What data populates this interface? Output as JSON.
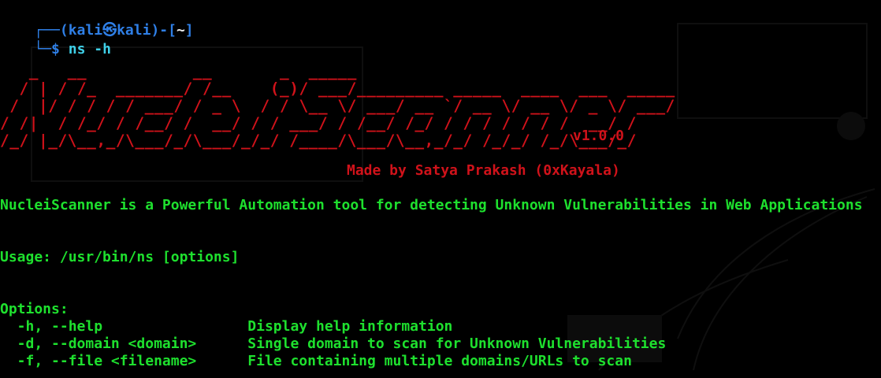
{
  "colors": {
    "background": "#000000",
    "prompt_blue": "#2f7fe6",
    "command_cyan": "#3fd0e8",
    "banner_red": "#d0121a",
    "text_green": "#1ee02e"
  },
  "prompt": {
    "top_deco": "┌──(",
    "user": "kali",
    "skull": "㉿",
    "host": "kali",
    "close": ")-[",
    "dir": "~",
    "end": "]",
    "bottom_deco": "└─",
    "dollar": "$ ",
    "command": "ns -h"
  },
  "banner": {
    "ascii_art": "   _   __           __       _  _____\n  / | / /_  _______/ /__    (_)/ ___/_________ _____  ____  ___  _____\n /  |/ / / / / ___/ / _ \\  / / \\__ \\/ ___/ __ `/ __ \\/ __ \\/ _ \\/ ___/\n/ /|  / /_/ / /__/ /  __/ / / ___/ / /__/ /_/ / / / / / / /  __/ /\n/_/ |_/\\__,_/\\___/_/\\___/_/_/ /____/\\___/\\__,_/_/ /_/_/ /_/\\___/_/",
    "version": "v1.0.0",
    "author": "Made by Satya Prakash (0xKayala)"
  },
  "description": "NucleiScanner is a Powerful Automation tool for detecting Unknown Vulnerabilities in Web Applications",
  "usage": "Usage: /usr/bin/ns [options]",
  "options_header": "Options:",
  "options": [
    {
      "flag": "  -h, --help                 ",
      "desc": "Display help information"
    },
    {
      "flag": "  -d, --domain <domain>      ",
      "desc": "Single domain to scan for Unknown Vulnerabilities"
    },
    {
      "flag": "  -f, --file <filename>      ",
      "desc": "File containing multiple domains/URLs to scan"
    }
  ]
}
